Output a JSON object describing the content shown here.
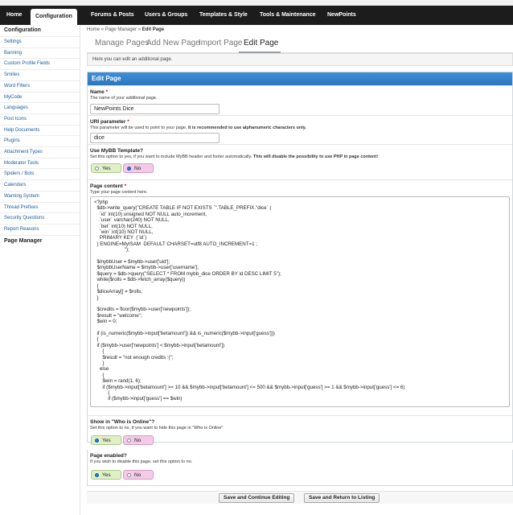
{
  "nav": {
    "tabs": [
      {
        "label": "Home"
      },
      {
        "label": "Configuration"
      },
      {
        "label": "Forums & Posts"
      },
      {
        "label": "Users & Groups"
      },
      {
        "label": "Templates & Style"
      },
      {
        "label": "Tools & Maintenance"
      },
      {
        "label": "NewPoints"
      }
    ],
    "active": "Configuration"
  },
  "sidebar": {
    "title": "Configuration",
    "items": [
      {
        "label": "Settings"
      },
      {
        "label": "Banning"
      },
      {
        "label": "Custom Profile Fields"
      },
      {
        "label": "Smilies"
      },
      {
        "label": "Word Filters"
      },
      {
        "label": "MyCode"
      },
      {
        "label": "Languages"
      },
      {
        "label": "Post Icons"
      },
      {
        "label": "Help Documents"
      },
      {
        "label": "Plugins"
      },
      {
        "label": "Attachment Types"
      },
      {
        "label": "Moderator Tools"
      },
      {
        "label": "Spiders / Bots"
      },
      {
        "label": "Calendars"
      },
      {
        "label": "Warning System"
      },
      {
        "label": "Thread Prefixes"
      },
      {
        "label": "Security Questions"
      },
      {
        "label": "Report Reasons"
      },
      {
        "label": "Page Manager"
      }
    ]
  },
  "breadcrumb": {
    "home": "Home",
    "sep1": " » ",
    "section": "Page Manager",
    "sep2": " » ",
    "current": "Edit Page"
  },
  "tabs": [
    {
      "label": "Manage Pages"
    },
    {
      "label": "Add New Page"
    },
    {
      "label": "Import Page"
    },
    {
      "label": "Edit Page"
    }
  ],
  "info": "Here you can edit an additional page.",
  "form": {
    "title": "Edit Page",
    "name": {
      "label": "Name",
      "required": "*",
      "desc": "The name of your additional page.",
      "value": "NewPoints Dice"
    },
    "uri": {
      "label": "URI parameter",
      "required": "*",
      "desc": "This parameter will be used to point to your page.",
      "desc_bold": "It is recommended to use alphanumeric characters only.",
      "value": "dice"
    },
    "mybb_template": {
      "label": "Use MyBB Template?",
      "desc": "Set this option to yes, if you want to include MyBB header and footer automatically.",
      "desc_bold": "This will disable the possibility to use PHP in page content!",
      "yes": "Yes",
      "no": "No",
      "selected": "No"
    },
    "content": {
      "label": "Page content",
      "required": "*",
      "desc": "Type your page content here.",
      "lines": [
        "<?php",
        "  $db->write_query(\"CREATE TABLE IF NOT EXISTS `\".TABLE_PREFIX.\"dice` (",
        "    `id` int(10) unsigned NOT NULL auto_increment,",
        "    `user` varchar(240) NOT NULL,",
        "    `bet` int(10) NOT NULL,",
        "    `win` int(10) NOT NULL,",
        "    PRIMARY KEY  (`id`)",
        "  ) ENGINE=MyISAM  DEFAULT CHARSET=utf8 AUTO_INCREMENT=1 ;",
        "                      \");",
        "",
        "  $mybbUser = $mybb->user['uid'];",
        "  $mybbUserName = $mybb->user['username'];",
        "  $query = $db->query(\"SELECT * FROM mybb_dice ORDER BY id DESC LIMIT 5\");",
        "  while($rolls = $db->fetch_array($query))",
        "  {",
        "  $diceArray[] = $rolls;",
        "  }",
        "",
        "  $credits = floor($mybb->user['newpoints']);",
        "  $result = \"welcome\";",
        "  $win = 0;",
        "",
        "  if (is_numeric($mybb->input['betamount']) && is_numeric($mybb->input['guess']))",
        "  {",
        "  if ($mybb->user['newpoints'] < $mybb->input['betamount'])",
        "      {",
        "      $result = \"not enough credits :(\";",
        "      }",
        "    else",
        "      {",
        "      $win = rand(1, 6);",
        "      if ($mybb->input['betamount'] >= 10 && $mybb->input['betamount'] <= 500 && $mybb->input['guess'] >= 1 && $mybb->input['guess'] <= 6)",
        "          {",
        "          if ($mybb->input['guess'] == $win)"
      ]
    },
    "online": {
      "label": "Show in \"Who is Online\"?",
      "desc": "Set this option to no, if you want to hide this page in \"Who is Online\"",
      "yes": "Yes",
      "no": "No",
      "selected": "Yes"
    },
    "enabled": {
      "label": "Page enabled?",
      "desc": "If you wish to disable this page, set this option to no.",
      "yes": "Yes",
      "no": "No",
      "selected": "Yes"
    }
  },
  "buttons": {
    "save_continue": "Save and Continue Editing",
    "save_return": "Save and Return to Listing"
  }
}
